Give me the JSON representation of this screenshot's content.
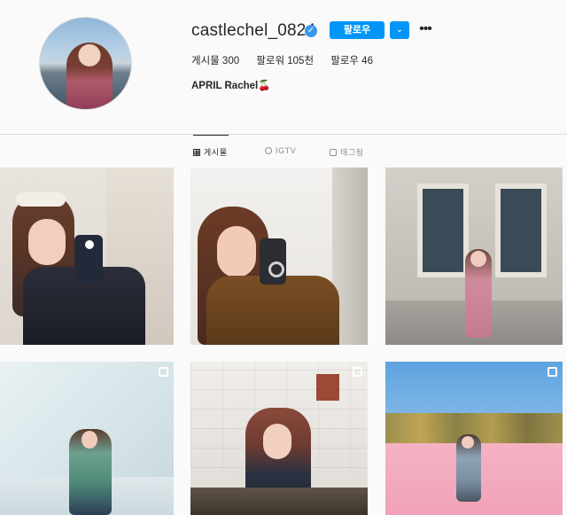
{
  "profile": {
    "username": "castlechel_0824",
    "verified_icon": "verified-badge-icon",
    "follow_label": "팔로우",
    "dropdown_icon": "chevron-down-icon",
    "more_icon": "more-options-icon",
    "stats": {
      "posts": "게시물 300",
      "followers": "팔로워 105천",
      "following": "팔로우 46"
    },
    "full_name": "APRIL Rachel🍒"
  },
  "tabs": [
    {
      "label": "게시물",
      "icon": "grid-icon",
      "active": true
    },
    {
      "label": "IGTV",
      "icon": "tv-icon",
      "active": false
    },
    {
      "label": "태그됨",
      "icon": "tagged-icon",
      "active": false
    }
  ],
  "colors": {
    "accent": "#0095f6",
    "background": "#fafafa",
    "divider": "#dbdbdb"
  },
  "posts": [
    {
      "description": "mirror-selfie",
      "multi": false
    },
    {
      "description": "mirror-selfie",
      "multi": false
    },
    {
      "description": "building-facade",
      "multi": false
    },
    {
      "description": "studio-pose",
      "multi": true
    },
    {
      "description": "brick-wall",
      "multi": true
    },
    {
      "description": "pink-field",
      "multi": true
    }
  ]
}
